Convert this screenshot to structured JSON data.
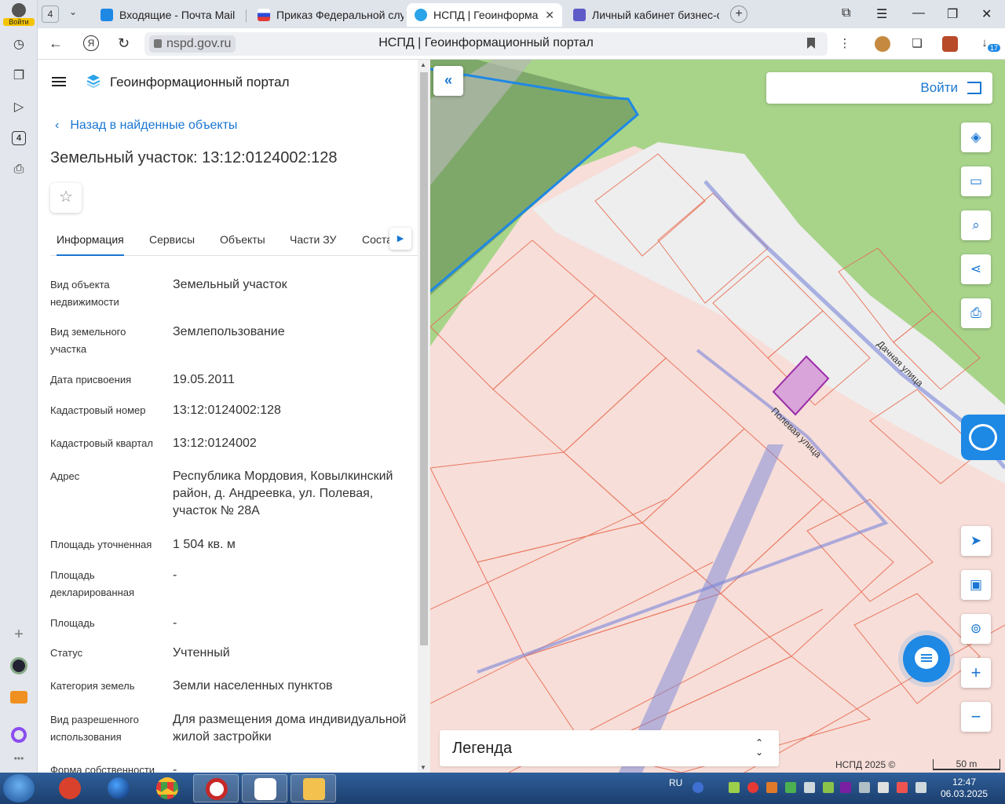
{
  "rail": {
    "login_label": "Войти",
    "tab_badge": "4"
  },
  "tabbar": {
    "count": "4",
    "tabs": [
      {
        "label": "Входящие - Почта Mail"
      },
      {
        "label": "Приказ Федеральной слу"
      },
      {
        "label": "НСПД | Геоинформаци",
        "active": true
      },
      {
        "label": "Личный кабинет бизнес-с"
      }
    ]
  },
  "addressbar": {
    "url": "nspd.gov.ru",
    "title": "НСПД | Геоинформационный портал",
    "downloads_count": "17"
  },
  "panel": {
    "app_title": "Геоинформационный портал",
    "back_label": "Назад в найденные объекты",
    "object_title": "Земельный участок: 13:12:0124002:128",
    "tabs": [
      "Информация",
      "Сервисы",
      "Объекты",
      "Части ЗУ",
      "Соста"
    ],
    "rows": [
      {
        "key": "Вид объекта недвижимости",
        "value": "Земельный участок"
      },
      {
        "key": "Вид земельного участка",
        "value": "Землепользование"
      },
      {
        "key": "Дата присвоения",
        "value": "19.05.2011"
      },
      {
        "key": "Кадастровый номер",
        "value": "13:12:0124002:128"
      },
      {
        "key": "Кадастровый квартал",
        "value": "13:12:0124002"
      },
      {
        "key": "Адрес",
        "value": "Республика Мордовия, Ковылкинский район, д. Андреевка, ул. Полевая, участок № 28А"
      },
      {
        "key": "Площадь уточненная",
        "value": "1 504 кв. м"
      },
      {
        "key": "Площадь декларированная",
        "value": "-"
      },
      {
        "key": "Площадь",
        "value": "-"
      },
      {
        "key": "Статус",
        "value": "Учтенный"
      },
      {
        "key": "Категория земель",
        "value": "Земли населенных пунктов"
      },
      {
        "key": "Вид разрешенного использования",
        "value": "Для размещения дома индивидуальной жилой застройки"
      },
      {
        "key": "Форма собственности",
        "value": "-"
      }
    ]
  },
  "map": {
    "login_label": "Войти",
    "legend_label": "Легенда",
    "copyright": "НСПД 2025 ©",
    "scale_label": "50 m",
    "streets": [
      "Дачная улица",
      "Полевая улица"
    ]
  },
  "taskbar": {
    "lang": "RU",
    "time": "12:47",
    "date": "06.03.2025"
  }
}
